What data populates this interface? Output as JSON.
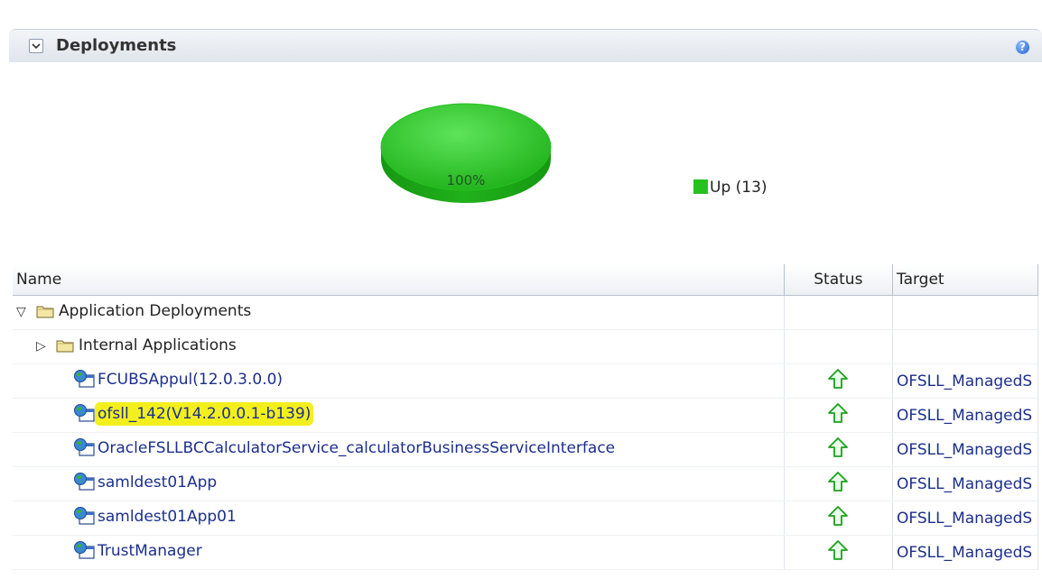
{
  "panel": {
    "title": "Deployments",
    "help_glyph": "?"
  },
  "chart_data": {
    "type": "pie",
    "slices": [
      {
        "label": "Up",
        "count": 13,
        "percent": 100,
        "color": "#27c21f"
      }
    ],
    "slice_label": "100%",
    "legend": [
      {
        "text": "Up (13)",
        "color": "#27c21f"
      }
    ],
    "legend_position": "right"
  },
  "table": {
    "headers": {
      "name": "Name",
      "status": "Status",
      "target": "Target"
    },
    "groups": [
      {
        "label": "Application Deployments",
        "toggle": "▽"
      },
      {
        "label": "Internal Applications",
        "toggle": "▷"
      }
    ],
    "rows": [
      {
        "name": "FCUBSAppul(12.0.3.0.0)",
        "status": "up",
        "target": "OFSLL_ManagedS",
        "highlight": false
      },
      {
        "name": "ofsll_142(V14.2.0.0.1-b139)",
        "status": "up",
        "target": "OFSLL_ManagedS",
        "highlight": true
      },
      {
        "name": "OracleFSLLBCCalculatorService_calculatorBusinessServiceInterface",
        "status": "up",
        "target": "OFSLL_ManagedS",
        "highlight": false
      },
      {
        "name": "samldest01App",
        "status": "up",
        "target": "OFSLL_ManagedS",
        "highlight": false
      },
      {
        "name": "samldest01App01",
        "status": "up",
        "target": "OFSLL_ManagedS",
        "highlight": false
      },
      {
        "name": "TrustManager",
        "status": "up",
        "target": "OFSLL_ManagedS",
        "highlight": false
      }
    ]
  },
  "icons": {
    "collapse": "chevron-down-icon",
    "help": "help-icon",
    "folder": "folder-icon",
    "app": "application-icon",
    "status_up": "arrow-up-icon"
  }
}
